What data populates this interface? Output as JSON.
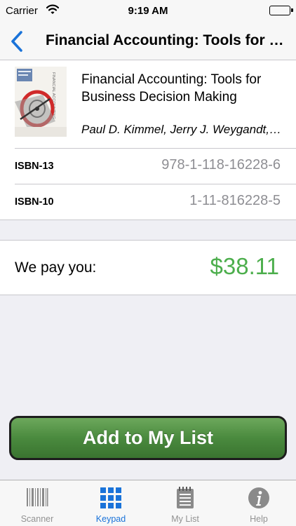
{
  "status_bar": {
    "carrier": "Carrier",
    "time": "9:19 AM"
  },
  "nav": {
    "title": "Financial Accounting: Tools for Business Decision Making",
    "back_icon": "chevron-left-icon"
  },
  "book": {
    "cover_title": "FINANCIAL ACCOUNTING",
    "title": "Financial Accounting: Tools for Business Decision Making",
    "authors": "Paul D. Kimmel, Jerry J. Weygandt, Donald E. Kieso",
    "isbn13": {
      "label": "ISBN-13",
      "value": "978-1-118-16228-6"
    },
    "isbn10": {
      "label": "ISBN-10",
      "value": "1-11-816228-5"
    }
  },
  "offer": {
    "label": "We pay you:",
    "amount": "$38.11",
    "amount_color": "#4cae4c"
  },
  "actions": {
    "add_label": "Add to My List"
  },
  "tabs": [
    {
      "label": "Scanner",
      "icon": "barcode-icon",
      "active": false
    },
    {
      "label": "Keypad",
      "icon": "keypad-icon",
      "active": true
    },
    {
      "label": "My List",
      "icon": "notepad-icon",
      "active": false
    },
    {
      "label": "Help",
      "icon": "info-icon",
      "active": false
    }
  ],
  "colors": {
    "accent": "#1a73d9",
    "inactive_tab": "#929292",
    "button_green": "#4a8a3e"
  }
}
